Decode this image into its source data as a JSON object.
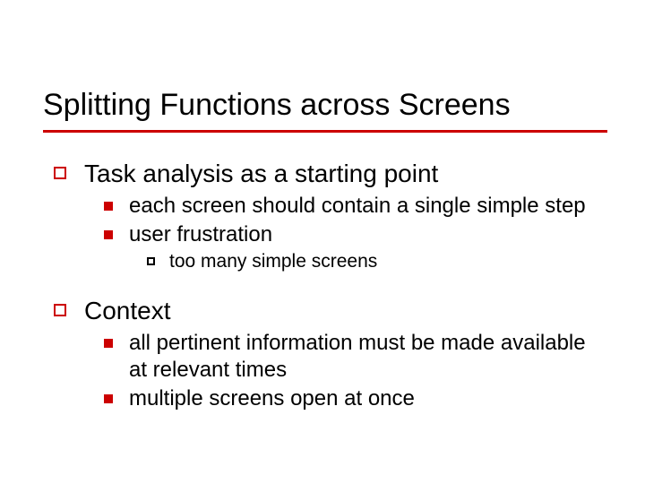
{
  "title": "Splitting Functions across Screens",
  "outline": [
    {
      "text": "Task analysis as a starting point",
      "children": [
        {
          "text": "each screen should contain a single simple step"
        },
        {
          "text": "user frustration",
          "children": [
            {
              "text": "too many simple screens"
            }
          ]
        }
      ]
    },
    {
      "text": "Context",
      "children": [
        {
          "text": "all pertinent information must be made available at relevant times"
        },
        {
          "text": "multiple screens open at once"
        }
      ]
    }
  ]
}
